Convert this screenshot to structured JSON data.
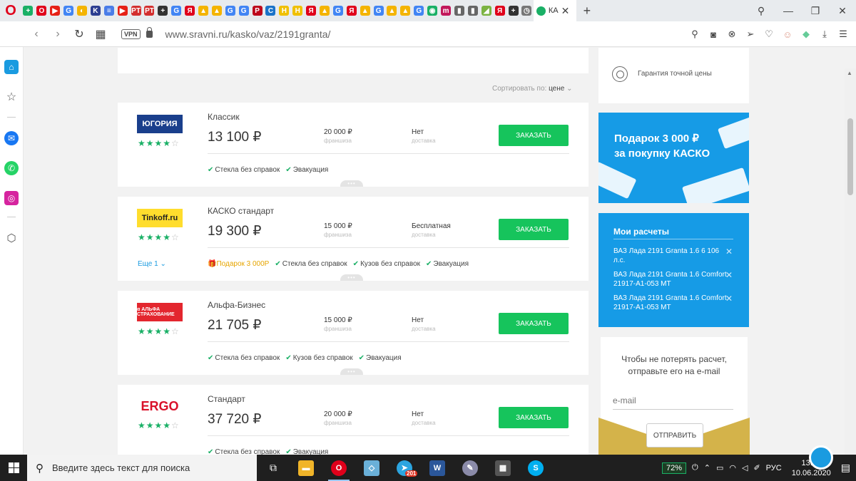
{
  "browser": {
    "logo": "O",
    "pinned_tabs": [
      {
        "glyph": "+",
        "color": "#1ab066"
      },
      {
        "glyph": "O",
        "color": "#e0001b"
      },
      {
        "glyph": "▶",
        "color": "#e62117"
      },
      {
        "glyph": "G",
        "color": "#4285f4"
      },
      {
        "glyph": "◐",
        "color": "#f4b400"
      },
      {
        "glyph": "K",
        "color": "#2c3e91"
      },
      {
        "glyph": "≡",
        "color": "#4a7de8"
      },
      {
        "glyph": "▶",
        "color": "#e62117"
      },
      {
        "glyph": "PT",
        "color": "#d32f2f"
      },
      {
        "glyph": "PT",
        "color": "#d32f2f"
      },
      {
        "glyph": "+",
        "color": "#333333"
      },
      {
        "glyph": "G",
        "color": "#4285f4"
      },
      {
        "glyph": "Я",
        "color": "#e0001b"
      },
      {
        "glyph": "▲",
        "color": "#f4b400"
      },
      {
        "glyph": "▲",
        "color": "#f4b400"
      },
      {
        "glyph": "G",
        "color": "#4285f4"
      },
      {
        "glyph": "G",
        "color": "#4285f4"
      },
      {
        "glyph": "P",
        "color": "#bd081c"
      },
      {
        "glyph": "C",
        "color": "#1a73c9"
      },
      {
        "glyph": "H",
        "color": "#f0c000"
      },
      {
        "glyph": "H",
        "color": "#f0c000"
      },
      {
        "glyph": "Я",
        "color": "#e0001b"
      },
      {
        "glyph": "▲",
        "color": "#f4b400"
      },
      {
        "glyph": "G",
        "color": "#4285f4"
      },
      {
        "glyph": "Я",
        "color": "#e0001b"
      },
      {
        "glyph": "▲",
        "color": "#f4b400"
      },
      {
        "glyph": "G",
        "color": "#4285f4"
      },
      {
        "glyph": "▲",
        "color": "#f4b400"
      },
      {
        "glyph": "▲",
        "color": "#f4b400"
      },
      {
        "glyph": "G",
        "color": "#4285f4"
      },
      {
        "glyph": "◉",
        "color": "#1ab066"
      },
      {
        "glyph": "m",
        "color": "#c2185b"
      },
      {
        "glyph": "▮",
        "color": "#666666"
      },
      {
        "glyph": "▮",
        "color": "#666666"
      },
      {
        "glyph": "◢",
        "color": "#7cb342"
      },
      {
        "glyph": "Я",
        "color": "#e0001b"
      },
      {
        "glyph": "+",
        "color": "#333333"
      },
      {
        "glyph": "◷",
        "color": "#777777"
      }
    ],
    "active_tab": {
      "title": "КА"
    },
    "url": "www.sravni.ru/kasko/vaz/2191granta/",
    "vpn_label": "VPN"
  },
  "page": {
    "sort_label": "Сортировать по:",
    "sort_value": "цене",
    "franchise_label": "франшиза",
    "delivery_label": "доставка",
    "order_label": "ЗАКАЗАТЬ",
    "offers": [
      {
        "logo_text": "ЮГОРИЯ",
        "logo_bg": "#1a3f8c",
        "logo_color": "#ffffff",
        "stars": 4,
        "plan": "Классик",
        "price": "13 100 ₽",
        "franchise": "20 000 ₽",
        "delivery": "Нет",
        "more": "",
        "gift": "",
        "features": [
          "Стекла без справок",
          "Эвакуация"
        ]
      },
      {
        "logo_text": "Tinkoff.ru",
        "logo_bg": "#ffdd2d",
        "logo_color": "#222222",
        "stars": 4,
        "plan": "КАСКО стандарт",
        "price": "19 300 ₽",
        "franchise": "15 000 ₽",
        "delivery": "Бесплатная",
        "more": "Еще 1",
        "gift": "Подарок 3 000Р",
        "features": [
          "Стекла без справок",
          "Кузов без справок",
          "Эвакуация"
        ]
      },
      {
        "logo_text": "α АЛЬФА СТРАХОВАНИЕ",
        "logo_bg": "#e3262e",
        "logo_color": "#ffffff",
        "stars": 4,
        "plan": "Альфа-Бизнес",
        "price": "21 705 ₽",
        "franchise": "15 000 ₽",
        "delivery": "Нет",
        "more": "",
        "gift": "",
        "features": [
          "Стекла без справок",
          "Кузов без справок",
          "Эвакуация"
        ]
      },
      {
        "logo_text": "ERGO",
        "logo_bg": "#ffffff",
        "logo_color": "#d9112a",
        "stars": 4,
        "plan": "Стандарт",
        "price": "37 720 ₽",
        "franchise": "20 000 ₽",
        "delivery": "Нет",
        "more": "",
        "gift": "",
        "features": [
          "Стекла без справок",
          "Эвакуация"
        ]
      }
    ],
    "guarantee": "Гарантия точной цены",
    "promo_line1": "Подарок 3 000 ₽",
    "promo_line2": "за покупку КАСКО",
    "my_calcs": {
      "title": "Мои расчеты",
      "items": [
        "ВАЗ Лада 2191 Granta 1.6 6 106 л.с.",
        "ВАЗ Лада 2191 Granta 1.6 Comfort 21917-A1-053 MT",
        "ВАЗ Лада 2191 Granta 1.6 Comfort 21917-A1-053 MT"
      ]
    },
    "email_form": {
      "title": "Чтобы не потерять расчет, отправьте его на e-mail",
      "placeholder": "e-mail",
      "button": "ОТПРАВИТЬ"
    }
  },
  "taskbar": {
    "search_placeholder": "Введите здесь текст для поиска",
    "telegram_badge": "201",
    "battery": "72%",
    "language": "РУС",
    "time": "13:12",
    "date": "10.06.2020"
  },
  "colors": {
    "accent_green": "#16c45c",
    "accent_blue": "#169be6"
  }
}
